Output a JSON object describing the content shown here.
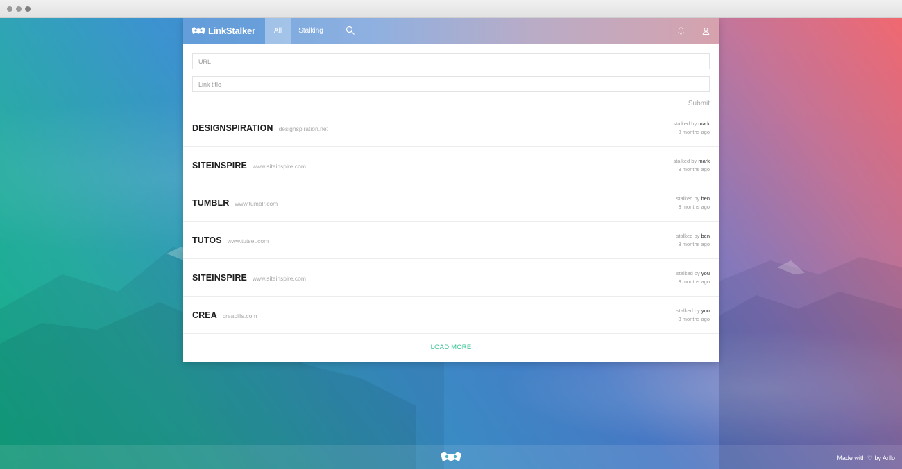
{
  "brand": {
    "name": "LinkStalker",
    "logo_icon": "raccoon-mask-icon"
  },
  "nav": {
    "tabs": [
      {
        "label": "All",
        "active": true
      },
      {
        "label": "Stalking",
        "active": false
      }
    ],
    "search_icon": "search-icon",
    "notifications_icon": "bell-icon",
    "profile_icon": "user-icon"
  },
  "form": {
    "url_placeholder": "URL",
    "title_placeholder": "Link title",
    "submit_label": "Submit"
  },
  "links": [
    {
      "name": "DESIGNSPIRATION",
      "domain": "designspiration.net",
      "prefix": "stalked by",
      "user": "mark",
      "time": "3 months ago"
    },
    {
      "name": "SITEINSPIRE",
      "domain": "www.siteinspire.com",
      "prefix": "stalked by",
      "user": "mark",
      "time": "3 months ago"
    },
    {
      "name": "TUMBLR",
      "domain": "www.tumblr.com",
      "prefix": "stalked by",
      "user": "ben",
      "time": "3 months ago"
    },
    {
      "name": "TUTOS",
      "domain": "www.tutset.com",
      "prefix": "stalked by",
      "user": "ben",
      "time": "3 months ago"
    },
    {
      "name": "SITEINSPIRE",
      "domain": "www.siteinspire.com",
      "prefix": "stalked by",
      "user": "you",
      "time": "3 months ago"
    },
    {
      "name": "CREA",
      "domain": "creapills.com",
      "prefix": "stalked by",
      "user": "you",
      "time": "3 months ago"
    }
  ],
  "load_more_label": "LOAD MORE",
  "footer": {
    "credit": "Made with ♡ by Arllo"
  },
  "colors": {
    "accent_green": "#2fc18c",
    "nav_blue": "#6fa7de",
    "nav_pink": "#d6a2ad"
  }
}
